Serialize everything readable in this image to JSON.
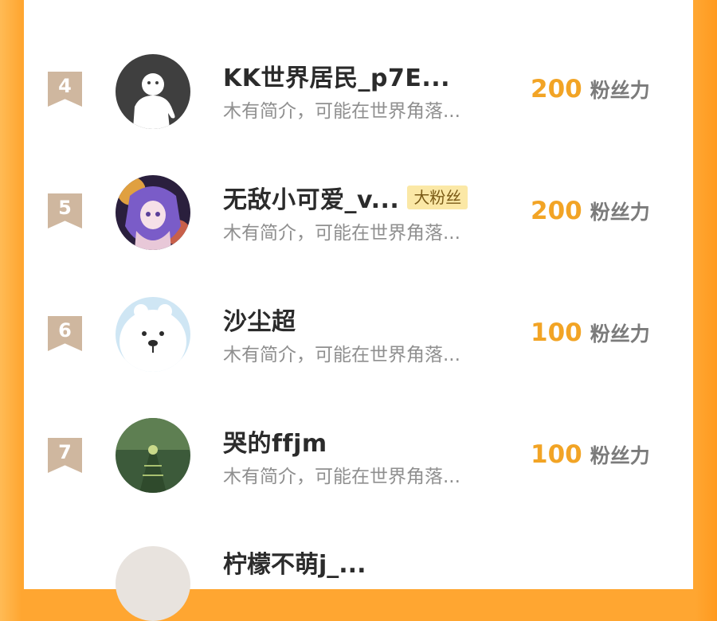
{
  "colors": {
    "background": "#ffa631",
    "card": "#ffffff",
    "rank_badge": "#cfb79f",
    "score": "#f2a425",
    "name": "#2b2b2b",
    "bio": "#8f8f8f",
    "fan_badge_bg": "#fbe8a6"
  },
  "ranking": {
    "entries": [
      {
        "rank": "4",
        "name": "KK世界居民_p7E...",
        "badge": "",
        "bio": "木有简介，可能在世界角落...",
        "score": "200",
        "unit": "粉丝力",
        "avatar_icon": "default-user-icon"
      },
      {
        "rank": "5",
        "name": "无敌小可爱_v...",
        "badge": "大粉丝",
        "bio": "木有简介，可能在世界角落...",
        "score": "200",
        "unit": "粉丝力",
        "avatar_icon": "anime-girl-avatar"
      },
      {
        "rank": "6",
        "name": "沙尘超",
        "badge": "",
        "bio": "木有简介，可能在世界角落...",
        "score": "100",
        "unit": "粉丝力",
        "avatar_icon": "polar-bear-avatar"
      },
      {
        "rank": "7",
        "name": "哭的ffjm",
        "badge": "",
        "bio": "木有简介，可能在世界角落...",
        "score": "100",
        "unit": "粉丝力",
        "avatar_icon": "game-scene-avatar"
      }
    ],
    "partial_next": {
      "name": "柠檬不萌j_...",
      "avatar_icon": "user-avatar"
    }
  }
}
